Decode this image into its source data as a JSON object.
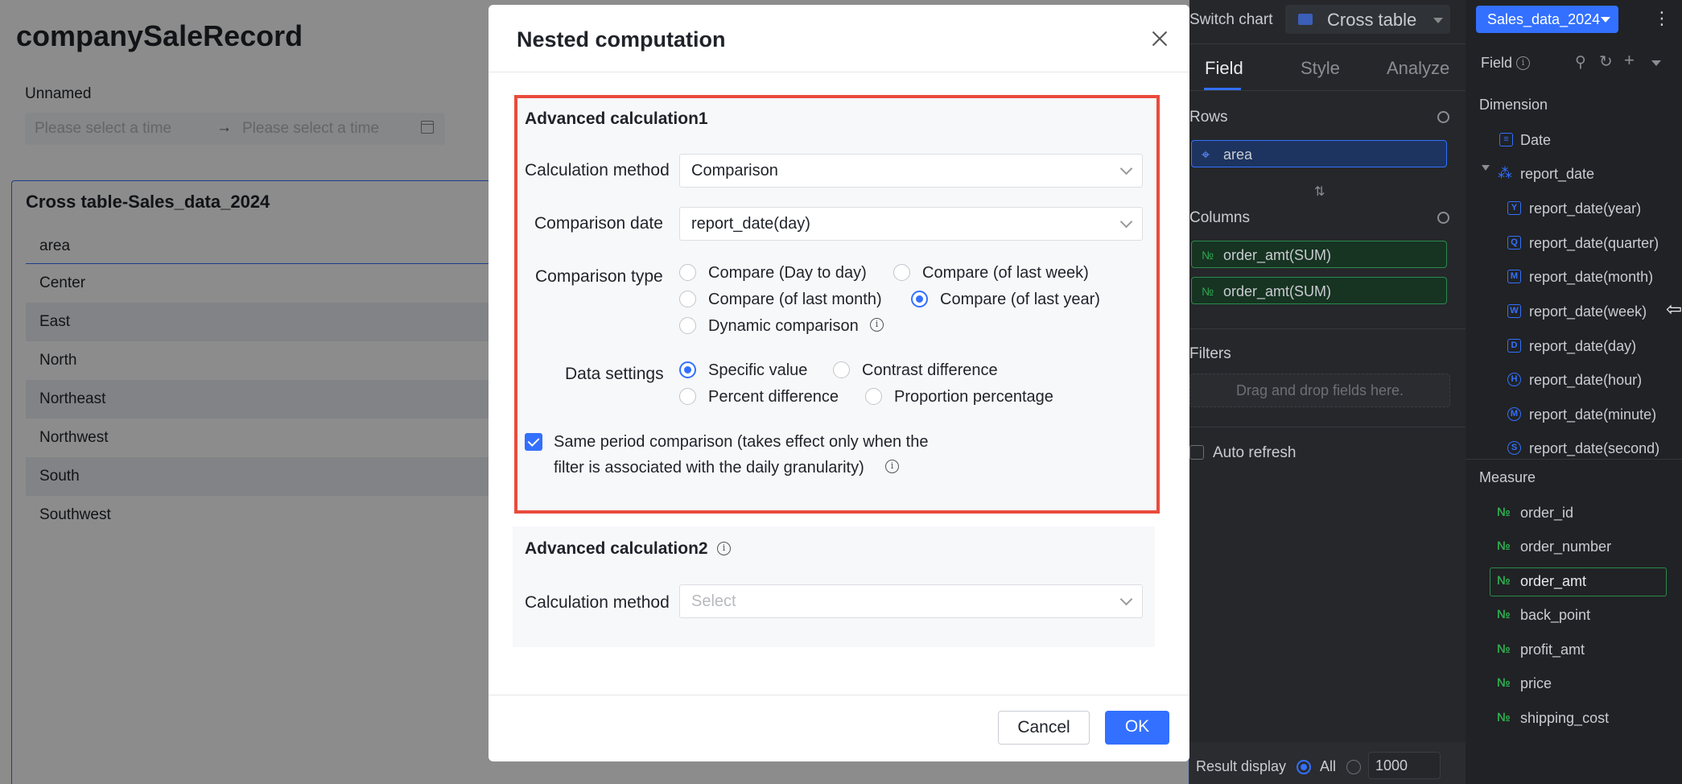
{
  "page": {
    "title": "companySaleRecord",
    "filter": {
      "label": "Unnamed",
      "start_placeholder": "Please select a time",
      "end_placeholder": "Please select a time"
    },
    "card": {
      "title": "Cross table-Sales_data_2024",
      "column_header": "area",
      "rows": [
        "Center",
        "East",
        "North",
        "Northeast",
        "Northwest",
        "South",
        "Southwest"
      ]
    }
  },
  "modal": {
    "title": "Nested computation",
    "adv1": {
      "title": "Advanced calculation1",
      "calc_method_label": "Calculation method",
      "calc_method_value": "Comparison",
      "comparison_date_label": "Comparison date",
      "comparison_date_value": "report_date(day)",
      "comparison_type_label": "Comparison type",
      "comparison_types": [
        "Compare (Day to day)",
        "Compare (of last week)",
        "Compare (of last month)",
        "Compare (of last year)",
        "Dynamic comparison"
      ],
      "comparison_type_selected": "Compare (of last year)",
      "data_settings_label": "Data settings",
      "data_settings": [
        "Specific value",
        "Contrast difference",
        "Percent difference",
        "Proportion percentage"
      ],
      "data_settings_selected": "Specific value",
      "same_period_line1": "Same period comparison (takes effect only when the",
      "same_period_line2": "filter is associated with the daily granularity)",
      "same_period_checked": true
    },
    "adv2": {
      "title": "Advanced calculation2",
      "calc_method_label": "Calculation method",
      "calc_method_placeholder": "Select"
    },
    "cancel": "Cancel",
    "ok": "OK"
  },
  "config_panel": {
    "switch_chart_label": "Switch chart",
    "chart_type": "Cross table",
    "tabs": [
      "Field",
      "Style",
      "Analyze"
    ],
    "active_tab": "Field",
    "rows_label": "Rows",
    "rows_fields": [
      "area"
    ],
    "columns_label": "Columns",
    "columns_fields": [
      "order_amt(SUM)",
      "order_amt(SUM)"
    ],
    "filters_label": "Filters",
    "filters_placeholder": "Drag and drop fields here.",
    "auto_refresh": "Auto refresh",
    "result_display_label": "Result display",
    "result_all": "All",
    "result_limit": "1000"
  },
  "field_panel": {
    "dataset": "Sales_data_2024",
    "field_label": "Field",
    "dimension_label": "Dimension",
    "dimensions": [
      {
        "label": "Date",
        "icon": "document-icon"
      },
      {
        "label": "report_date",
        "icon": "hierarchy-icon"
      },
      {
        "label": "report_date(year)",
        "icon": "Y"
      },
      {
        "label": "report_date(quarter)",
        "icon": "Q"
      },
      {
        "label": "report_date(month)",
        "icon": "M"
      },
      {
        "label": "report_date(week)",
        "icon": "W"
      },
      {
        "label": "report_date(day)",
        "icon": "D"
      },
      {
        "label": "report_date(hour)",
        "icon": "H"
      },
      {
        "label": "report_date(minute)",
        "icon": "M"
      },
      {
        "label": "report_date(second)",
        "icon": "S"
      }
    ],
    "measure_label": "Measure",
    "measures": [
      "order_id",
      "order_number",
      "order_amt",
      "back_point",
      "profit_amt",
      "price",
      "shipping_cost"
    ],
    "selected_measure": "order_amt",
    "measure_icon": "№"
  },
  "colors": {
    "accent": "#3370ff",
    "highlight_border": "#e94b3c",
    "dark_panel": "#25272b",
    "measure_green": "#2fa84f"
  }
}
